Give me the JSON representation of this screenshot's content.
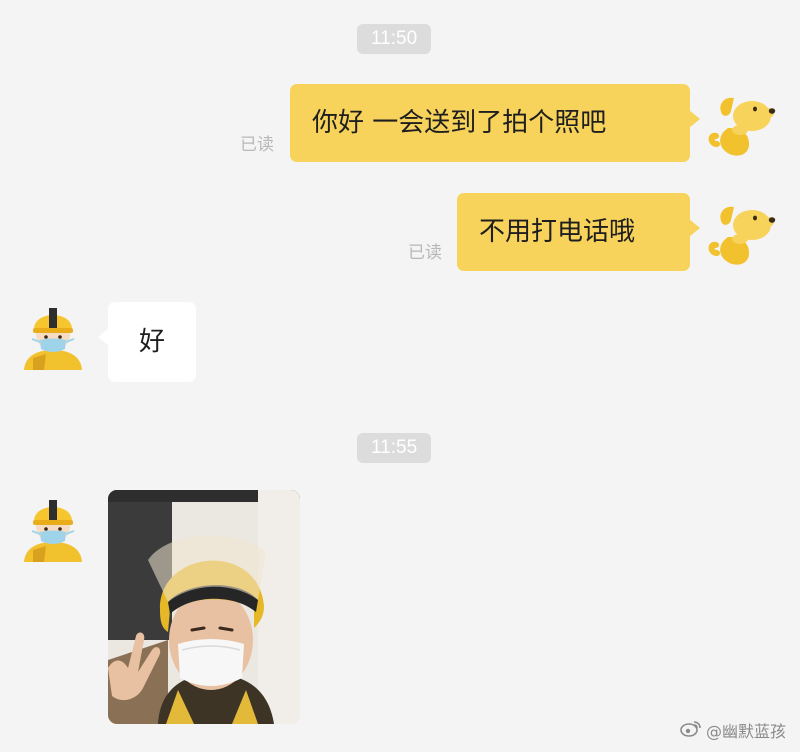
{
  "chat": {
    "timestamps": [
      "11:50",
      "11:55"
    ],
    "read_label": "已读",
    "messages": [
      {
        "side": "outgoing",
        "text": "你好 一会送到了拍个照吧"
      },
      {
        "side": "outgoing",
        "text": "不用打电话哦"
      },
      {
        "side": "incoming",
        "text": "好"
      },
      {
        "side": "incoming",
        "type": "photo",
        "content": "selfie of delivery rider in yellow helmet and face mask making a peace sign"
      }
    ]
  },
  "avatars": {
    "self": "yellow-dog-mascot-icon",
    "rider": "rider-helmet-mask-icon"
  },
  "watermark": {
    "icon": "weibo-icon",
    "text": "@幽默蓝孩"
  },
  "colors": {
    "background": "#f4f4f4",
    "outgoing_bubble": "#f7d35b",
    "incoming_bubble": "#ffffff",
    "timestamp_pill": "#dcdcdc",
    "read_text": "#b8b8b8"
  }
}
